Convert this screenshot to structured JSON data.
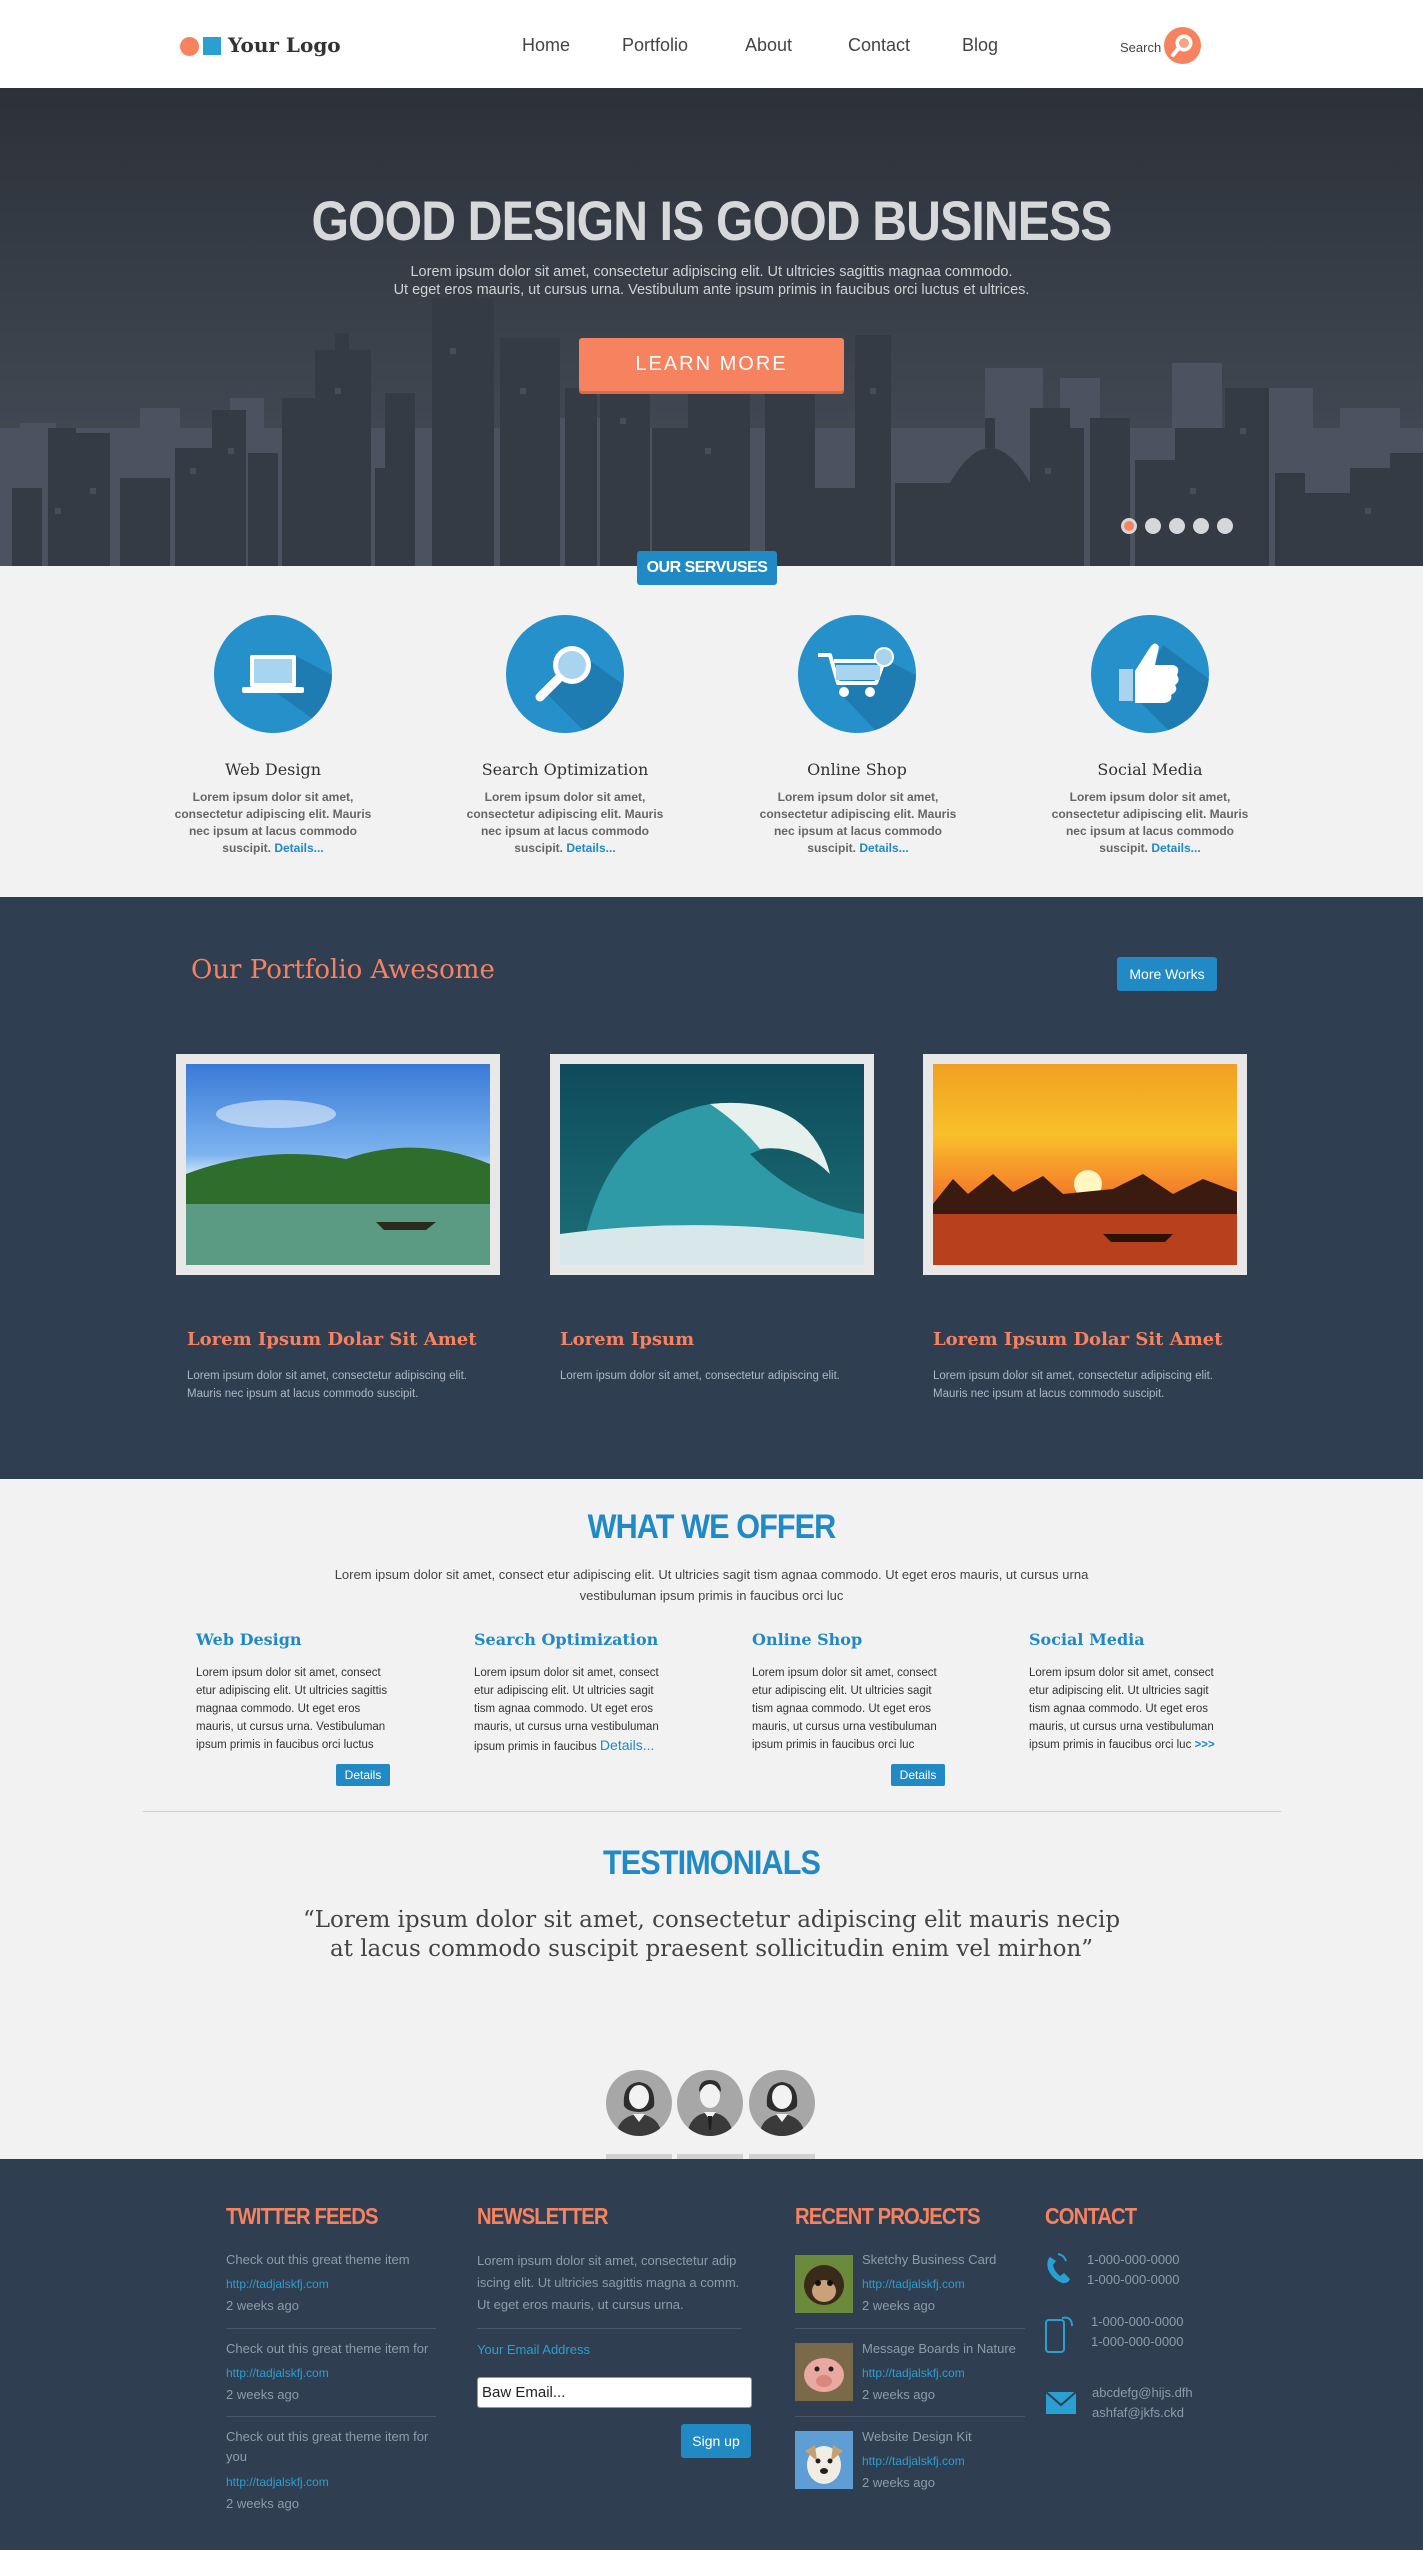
{
  "header": {
    "logo_text": "Your Logo",
    "nav": [
      "Home",
      "Portfolio",
      "About",
      "Contact",
      "Blog"
    ],
    "search_label": "Search"
  },
  "hero": {
    "title": "GOOD DESIGN IS GOOD BUSINESS",
    "subtitle_line1": "Lorem ipsum dolor sit amet, consectetur adipiscing elit. Ut ultricies sagittis magnaa commodo.",
    "subtitle_line2": "Ut eget eros mauris, ut cursus urna. Vestibulum ante ipsum primis in faucibus orci luctus et ultrices.",
    "button": "LEARN MORE",
    "slides": 5,
    "active_slide": 1
  },
  "services": {
    "badge": "OUR SERVUSES",
    "items": [
      {
        "title": "Web Design",
        "text": "Lorem ipsum dolor sit amet, consectetur adipiscing elit. Mauris nec ipsum at lacus commodo suscipit.",
        "link": "Details..."
      },
      {
        "title": "Search Optimization",
        "text": "Lorem ipsum dolor sit amet, consectetur adipiscing elit. Mauris nec ipsum at lacus commodo suscipit.",
        "link": "Details..."
      },
      {
        "title": "Online Shop",
        "text": "Lorem ipsum dolor sit amet, consectetur adipiscing elit. Mauris nec ipsum at lacus commodo suscipit.",
        "link": "Details..."
      },
      {
        "title": "Social Media",
        "text": "Lorem ipsum dolor sit amet, consectetur adipiscing elit. Mauris nec ipsum at lacus commodo suscipit.",
        "link": "Details..."
      }
    ]
  },
  "portfolio": {
    "title": "Our Portfolio Awesome",
    "more_works": "More Works",
    "items": [
      {
        "title": "Lorem Ipsum Dolar Sit Amet",
        "text_line1": "Lorem ipsum dolor sit amet, consectetur adipiscing elit.",
        "text_line2": "Mauris nec ipsum at lacus commodo suscipit."
      },
      {
        "title": "Lorem Ipsum",
        "text_line1": "Lorem ipsum dolor sit amet, consectetur adipiscing elit.",
        "text_line2": ""
      },
      {
        "title": "Lorem Ipsum Dolar Sit Amet",
        "text_line1": "Lorem ipsum dolor sit amet, consectetur adipiscing elit.",
        "text_line2": "Mauris nec ipsum at lacus commodo suscipit."
      }
    ]
  },
  "offer": {
    "title": "WHAT WE OFFER",
    "intro_line1": "Lorem ipsum dolor sit amet, consect etur adipiscing elit. Ut ultricies sagit tism agnaa commodo. Ut eget eros mauris, ut cursus urna",
    "intro_line2": "vestibuluman ipsum primis in faucibus orci luc",
    "items": [
      {
        "title": "Web Design",
        "text": "Lorem ipsum dolor sit amet, consect etur adipiscing elit. Ut ultricies sagittis magnaa commodo. Ut eget eros mauris, ut cursus urna. Vestibuluman ipsum primis in faucibus orci luctus",
        "link": "Details"
      },
      {
        "title": "Search Optimization",
        "text": "Lorem ipsum dolor sit amet, consect etur adipiscing elit. Ut ultricies sagit tism agnaa commodo. Ut eget eros mauris, ut cursus urna vestibuluman ipsum primis in faucibus",
        "link": "Details..."
      },
      {
        "title": "Online Shop",
        "text": "Lorem ipsum dolor sit amet, consect etur adipiscing elit. Ut ultricies sagit tism agnaa commodo. Ut eget eros mauris, ut cursus urna vestibuluman ipsum primis in faucibus orci luc",
        "link": "Details"
      },
      {
        "title": "Social Media",
        "text": "Lorem ipsum dolor sit amet, consect etur adipiscing elit. Ut ultricies sagit tism agnaa commodo. Ut eget eros mauris, ut cursus urna vestibuluman ipsum primis in faucibus orci luc",
        "link": ">>>"
      }
    ]
  },
  "testimonials": {
    "title": "TESTIMONIALS",
    "quote_line1": "“Lorem ipsum dolor sit amet, consectetur adipiscing elit mauris necip",
    "quote_line2": "at lacus commodo suscipit praesent sollicitudin enim vel mirhon”"
  },
  "footer": {
    "twitter": {
      "title": "TWITTER FEEDS",
      "items": [
        {
          "text": "Check out this great theme item",
          "link": "http://tadjalskfj.com",
          "time": "2 weeks ago"
        },
        {
          "text": "Check out this great theme item for",
          "link": "http://tadjalskfj.com",
          "time": "2 weeks ago"
        },
        {
          "text": "Check out this great theme item for you",
          "link": "http://tadjalskfj.com",
          "time": "2 weeks ago"
        }
      ]
    },
    "newsletter": {
      "title": "NEWSLETTER",
      "text": "Lorem ipsum dolor sit amet, consectetur adip iscing elit. Ut ultricies sagittis magna a comm. Ut eget eros mauris, ut cursus urna.",
      "email_label": "Your Email Address",
      "email_value": "Baw Email...",
      "button": "Sign up"
    },
    "projects": {
      "title": "RECENT PROJECTS",
      "items": [
        {
          "name": "Sketchy Business Card",
          "link": "http://tadjalskfj.com",
          "time": "2 weeks ago"
        },
        {
          "name": "Message Boards in Nature",
          "link": "http://tadjalskfj.com",
          "time": "2 weeks ago"
        },
        {
          "name": "Website Design Kit",
          "link": "http://tadjalskfj.com",
          "time": "2 weeks ago"
        }
      ]
    },
    "contact": {
      "title": "CONTACT",
      "phone1": "1-000-000-0000",
      "phone2": "1-000-000-0000",
      "mobile1": "1-000-000-0000",
      "mobile2": "1-000-000-0000",
      "email1": "abcdefg@hijs.dfh",
      "email2": "ashfaf@jkfs.ckd"
    }
  },
  "colors": {
    "accent_orange": "#f7825f",
    "accent_blue": "#2189c4",
    "dark_navy": "#2f3e51"
  }
}
